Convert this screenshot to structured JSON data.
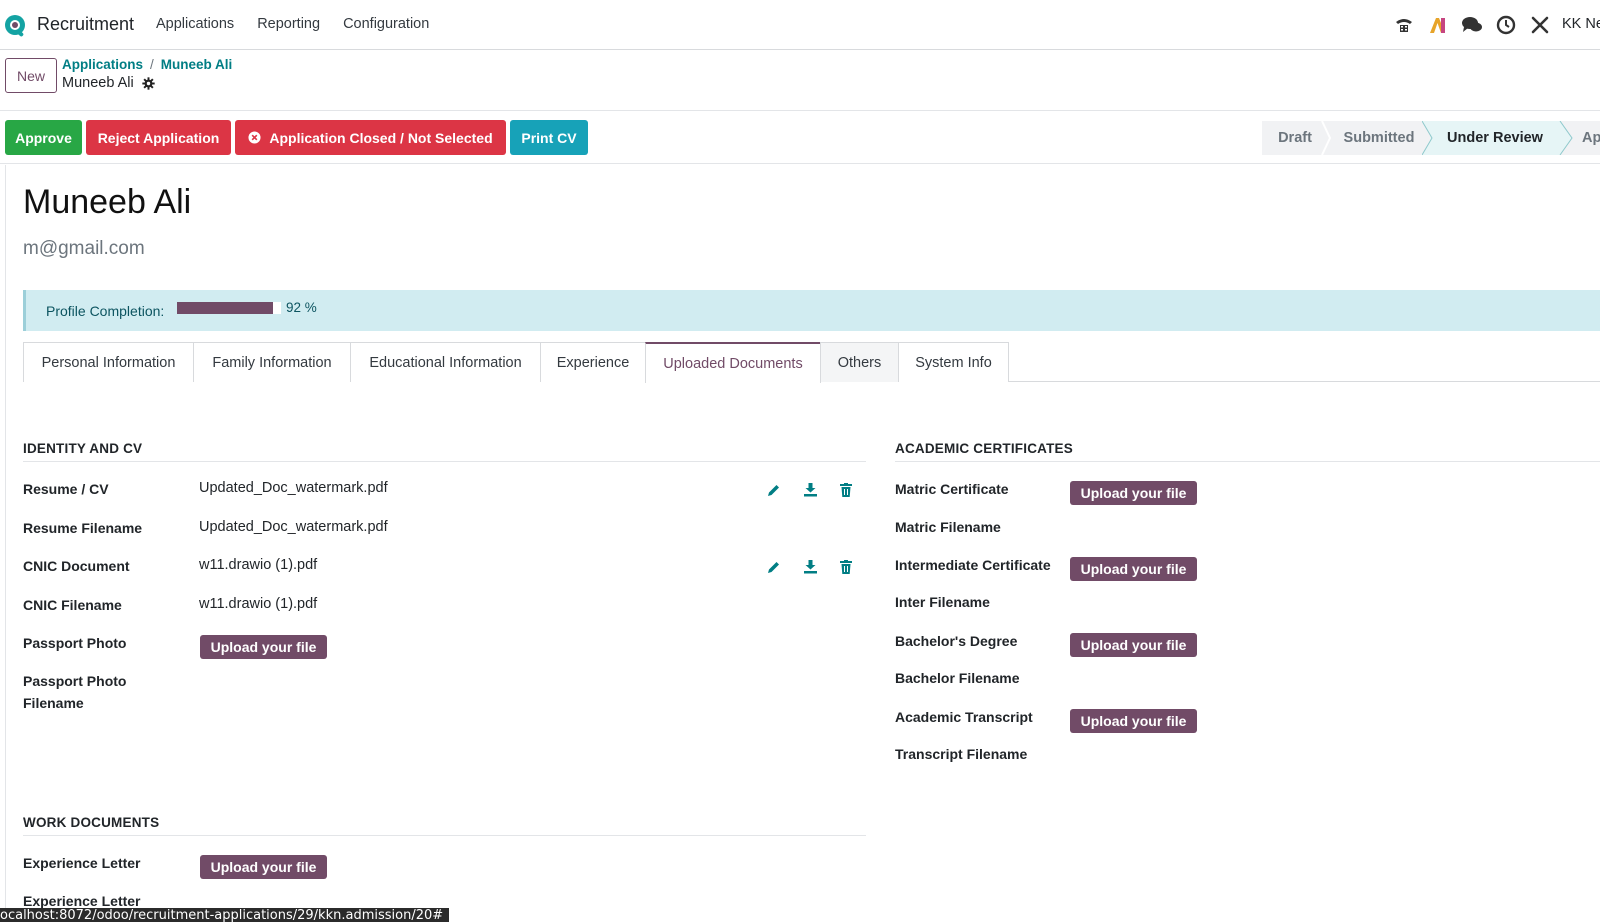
{
  "navbar": {
    "brand": "Recruitment",
    "menu": [
      "Applications",
      "Reporting",
      "Configuration"
    ],
    "icons": [
      "phone-icon",
      "ai-icon",
      "chat-icon",
      "clock-icon",
      "tools-icon"
    ],
    "user": "KK Ne"
  },
  "control_panel": {
    "new_label": "New",
    "breadcrumb": [
      "Applications",
      "Muneeb Ali"
    ],
    "breadcrumb_sep": "/",
    "record_name": "Muneeb Ali"
  },
  "status_bar": {
    "approve": "Approve",
    "reject": "Reject Application",
    "closed": "Application Closed / Not Selected",
    "print": "Print CV",
    "stages": [
      "Draft",
      "Submitted",
      "Under Review",
      "App"
    ],
    "current_stage": "Under Review"
  },
  "form": {
    "name": "Muneeb Ali",
    "email": "m@gmail.com",
    "completion_label": "Profile Completion:",
    "completion_value": 92,
    "completion_text": "92 %",
    "tabs": [
      "Personal Information",
      "Family Information",
      "Educational Information",
      "Experience",
      "Uploaded Documents",
      "Others",
      "System Info"
    ],
    "active_tab": "Uploaded Documents",
    "upload_label": "Upload your file",
    "identity": {
      "title": "IDENTITY AND CV",
      "resume_label": "Resume / CV",
      "resume_value": "Updated_Doc_watermark.pdf",
      "resume_filename_label": "Resume Filename",
      "resume_filename_value": "Updated_Doc_watermark.pdf",
      "cnic_label": "CNIC Document",
      "cnic_value": "w11.drawio (1).pdf",
      "cnic_filename_label": "CNIC Filename",
      "cnic_filename_value": "w11.drawio (1).pdf",
      "passport_label": "Passport Photo",
      "passport_filename_label_1": "Passport Photo",
      "passport_filename_label_2": "Filename"
    },
    "work": {
      "title": "WORK DOCUMENTS",
      "experience_letter_label": "Experience Letter",
      "experience_letter_filename_label": "Experience Letter"
    },
    "academic": {
      "title": "ACADEMIC CERTIFICATES",
      "matric_label": "Matric Certificate",
      "matric_filename_label": "Matric Filename",
      "inter_label": "Intermediate Certificate",
      "inter_filename_label": "Inter Filename",
      "bachelor_label": "Bachelor's Degree",
      "bachelor_filename_label": "Bachelor Filename",
      "transcript_label": "Academic Transcript",
      "transcript_filename_label": "Transcript Filename"
    }
  },
  "status_url": "ocalhost:8072/odoo/recruitment-applications/29/kkn.admission/20#",
  "colors": {
    "primary": "#714b67",
    "teal": "#017e84",
    "success": "#28a745",
    "danger": "#dc3545",
    "info": "#17a2b8",
    "alert_bg": "#d1ecf1"
  }
}
